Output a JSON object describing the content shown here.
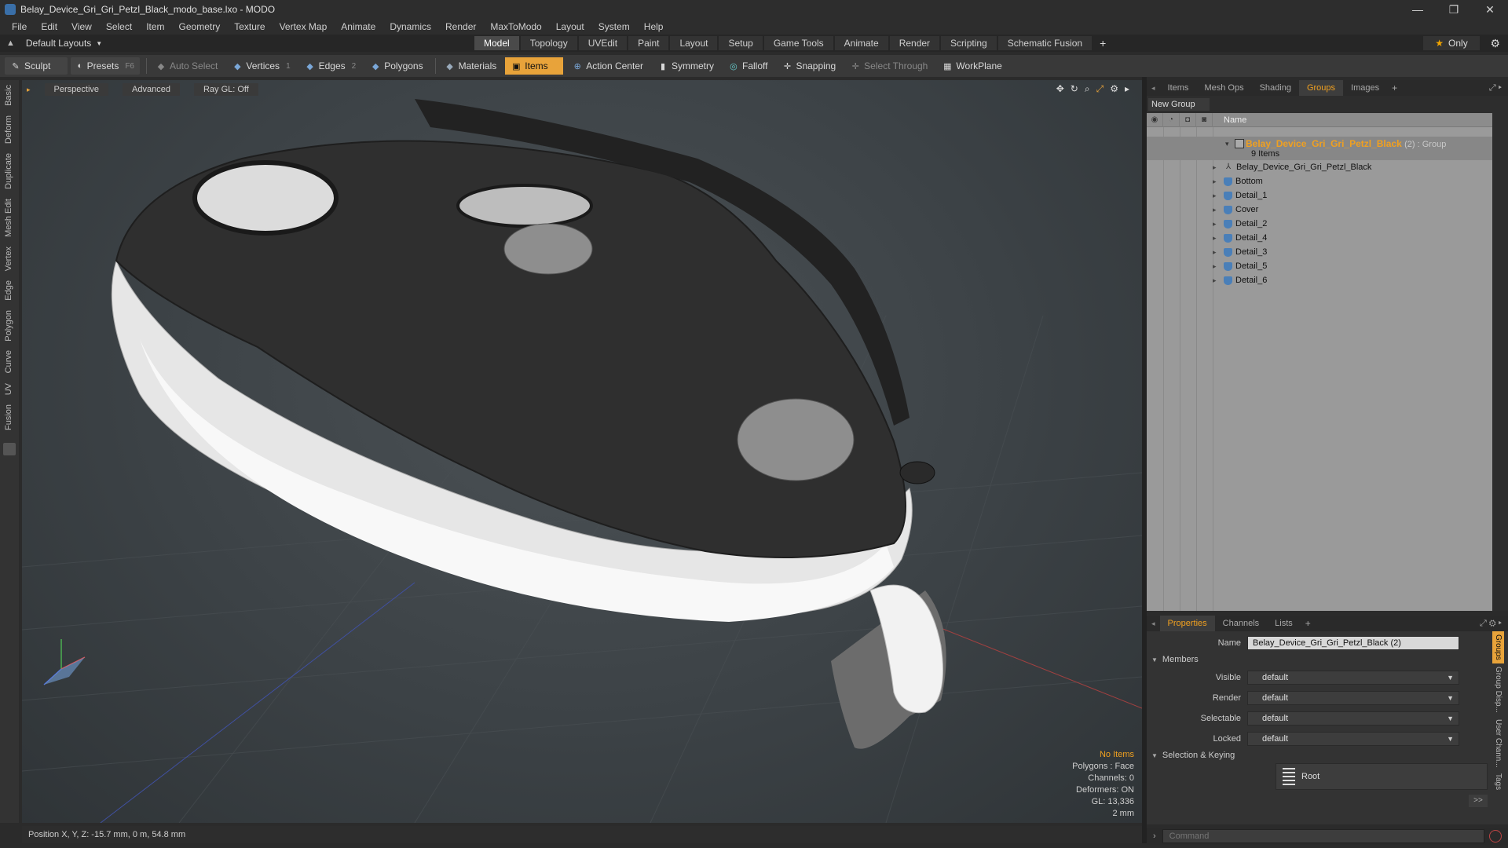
{
  "window": {
    "title": "Belay_Device_Gri_Gri_Petzl_Black_modo_base.lxo - MODO",
    "controls": [
      "—",
      "❐",
      "✕"
    ]
  },
  "menu": [
    "File",
    "Edit",
    "View",
    "Select",
    "Item",
    "Geometry",
    "Texture",
    "Vertex Map",
    "Animate",
    "Dynamics",
    "Render",
    "MaxToModo",
    "Layout",
    "System",
    "Help"
  ],
  "layoutbar": {
    "layout_select": "Default Layouts",
    "tabs": [
      "Model",
      "Topology",
      "UVEdit",
      "Paint",
      "Layout",
      "Setup",
      "Game Tools",
      "Animate",
      "Render",
      "Scripting",
      "Schematic Fusion"
    ],
    "active_tab": "Model",
    "add": "+",
    "only_label": "Only"
  },
  "toolbar": {
    "sculpt": "Sculpt",
    "presets": "Presets",
    "presets_key": "F6",
    "auto_select": "Auto Select",
    "vertices": "Vertices",
    "vertices_key": "1",
    "edges": "Edges",
    "edges_key": "2",
    "polygons": "Polygons",
    "materials": "Materials",
    "items": "Items",
    "action_center": "Action Center",
    "symmetry": "Symmetry",
    "falloff": "Falloff",
    "snapping": "Snapping",
    "select_through": "Select Through",
    "workplane": "WorkPlane"
  },
  "left_tabs": [
    "Basic",
    "Deform",
    "Duplicate",
    "Mesh Edit",
    "Vertex",
    "Edge",
    "Polygon",
    "Curve",
    "UV",
    "Fusion"
  ],
  "viewport": {
    "view_mode": "Perspective",
    "shading": "Advanced",
    "raygl": "Ray GL: Off",
    "info": {
      "selection": "No Items",
      "polygons": "Polygons : Face",
      "channels": "Channels: 0",
      "deformers": "Deformers: ON",
      "gl": "GL: 13,336",
      "grid": "2 mm"
    }
  },
  "status": {
    "position": "Position X, Y, Z:  -15.7 mm, 0 m, 54.8 mm"
  },
  "right_top": {
    "tabs": [
      "Items",
      "Mesh Ops",
      "Shading",
      "Groups",
      "Images"
    ],
    "active_tab": "Groups",
    "new_group": "New Group",
    "name_header": "Name",
    "group": {
      "name": "Belay_Device_Gri_Gri_Petzl_Black",
      "suffix": "(2) : Group",
      "count": "9 Items"
    },
    "items": [
      "Belay_Device_Gri_Gri_Petzl_Black",
      "Bottom",
      "Detail_1",
      "Cover",
      "Detail_2",
      "Detail_4",
      "Detail_3",
      "Detail_5",
      "Detail_6"
    ]
  },
  "right_bottom": {
    "tabs": [
      "Properties",
      "Channels",
      "Lists"
    ],
    "active_tab": "Properties",
    "name_label": "Name",
    "name_value": "Belay_Device_Gri_Gri_Petzl_Black (2)",
    "members_section": "Members",
    "visible_label": "Visible",
    "visible_value": "default",
    "render_label": "Render",
    "render_value": "default",
    "selectable_label": "Selectable",
    "selectable_value": "default",
    "locked_label": "Locked",
    "locked_value": "default",
    "selection_section": "Selection & Keying",
    "root_label": "Root",
    "more": ">>",
    "side_tabs": [
      "Groups",
      "Group Disp...",
      "User Chann...",
      "Tags"
    ]
  },
  "command": {
    "placeholder": "Command"
  },
  "colors": {
    "accent": "#e8a33a",
    "group_name": "#f0a020",
    "viewport_bg": "#3c4246"
  }
}
